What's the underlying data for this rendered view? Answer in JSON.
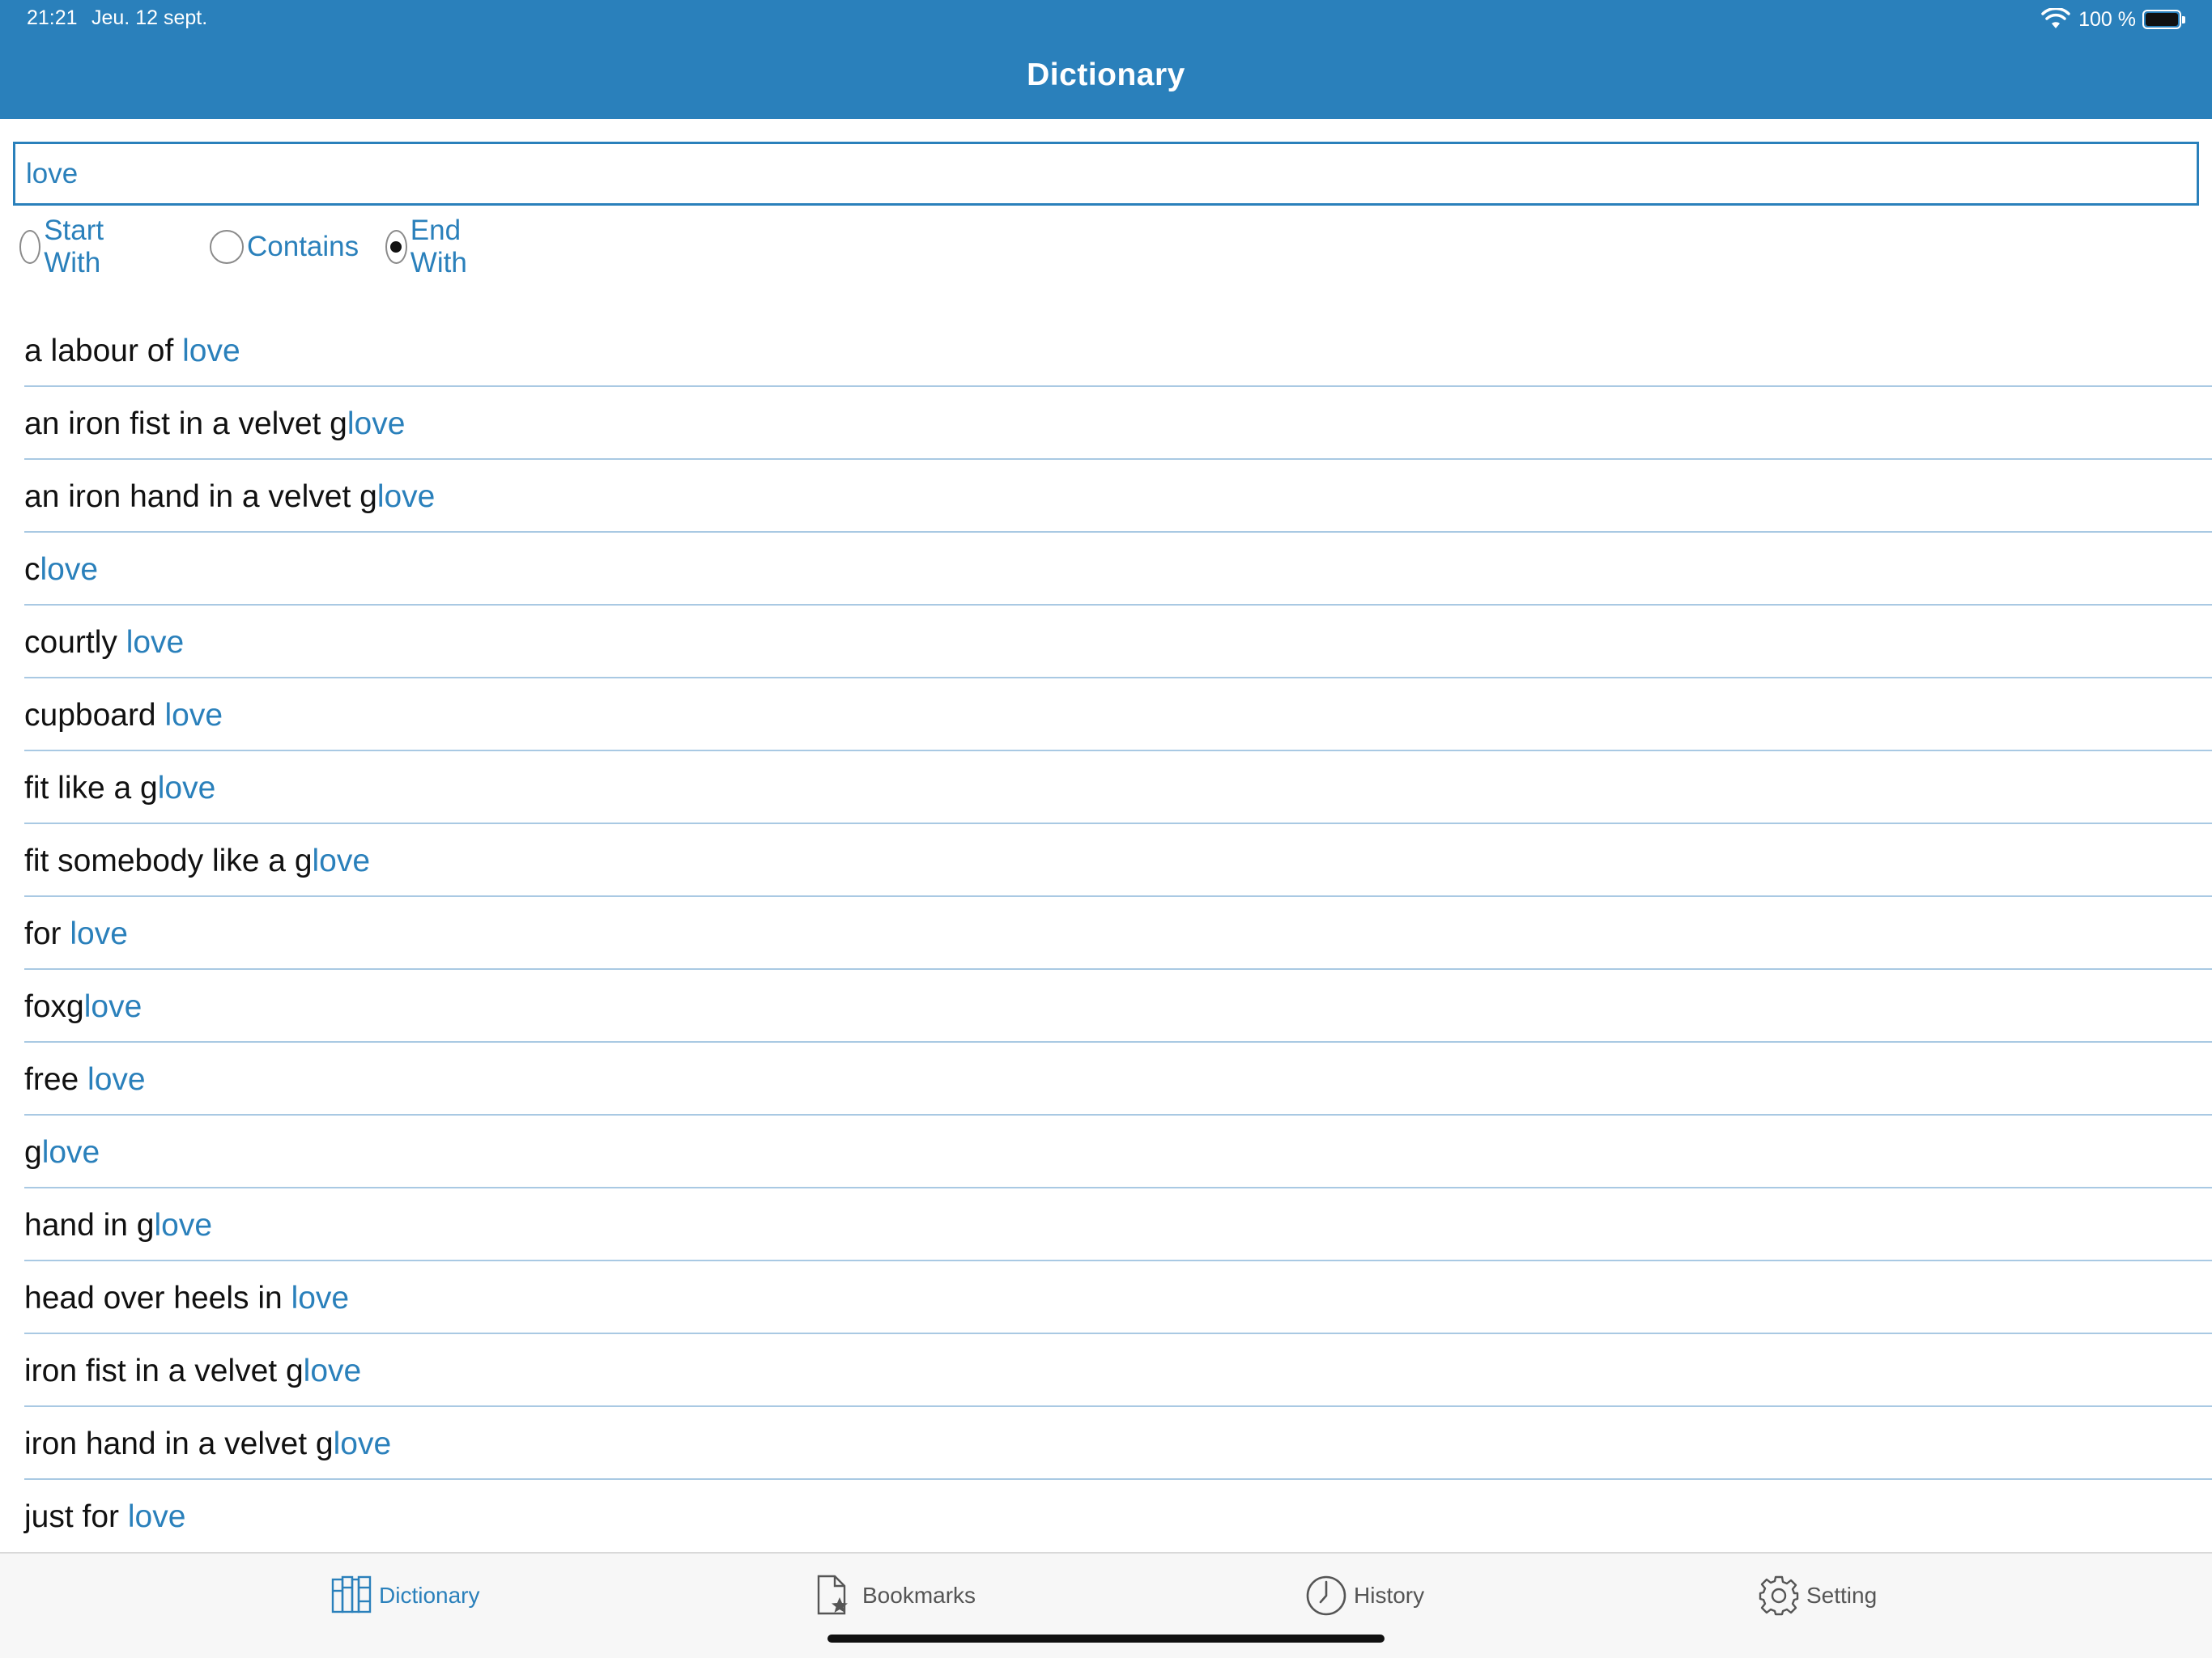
{
  "status_bar": {
    "time": "21:21",
    "date": "Jeu. 12 sept.",
    "battery_text": "100 %",
    "wifi_icon": "wifi-icon",
    "battery_icon": "battery-icon"
  },
  "header": {
    "title": "Dictionary"
  },
  "search": {
    "value": "love"
  },
  "options": {
    "selected": "End With",
    "items": [
      "Start With",
      "Contains",
      "End With"
    ]
  },
  "results": [
    {
      "pre": "a labour of ",
      "match": "love"
    },
    {
      "pre": "an iron fist in a velvet g",
      "match": "love"
    },
    {
      "pre": "an iron hand in a velvet g",
      "match": "love"
    },
    {
      "pre": "c",
      "match": "love"
    },
    {
      "pre": "courtly ",
      "match": "love"
    },
    {
      "pre": "cupboard ",
      "match": "love"
    },
    {
      "pre": "fit like a g",
      "match": "love"
    },
    {
      "pre": "fit somebody like a g",
      "match": "love"
    },
    {
      "pre": "for ",
      "match": "love"
    },
    {
      "pre": "foxg",
      "match": "love"
    },
    {
      "pre": "free ",
      "match": "love"
    },
    {
      "pre": "g",
      "match": "love"
    },
    {
      "pre": "hand in g",
      "match": "love"
    },
    {
      "pre": "head over heels in ",
      "match": "love"
    },
    {
      "pre": "iron fist in a velvet g",
      "match": "love"
    },
    {
      "pre": "iron hand in a velvet g",
      "match": "love"
    },
    {
      "pre": "just for ",
      "match": "love"
    }
  ],
  "tabs": [
    {
      "label": "Dictionary",
      "icon": "book-icon",
      "active": true
    },
    {
      "label": "Bookmarks",
      "icon": "bookmark-document-icon",
      "active": false
    },
    {
      "label": "History",
      "icon": "clock-icon",
      "active": false
    },
    {
      "label": "Setting",
      "icon": "gear-icon",
      "active": false
    }
  ],
  "colors": {
    "accent": "#2a80bb",
    "separator": "#a9c9e3",
    "text": "#111111",
    "tabbar_bg": "#f7f7f7"
  }
}
